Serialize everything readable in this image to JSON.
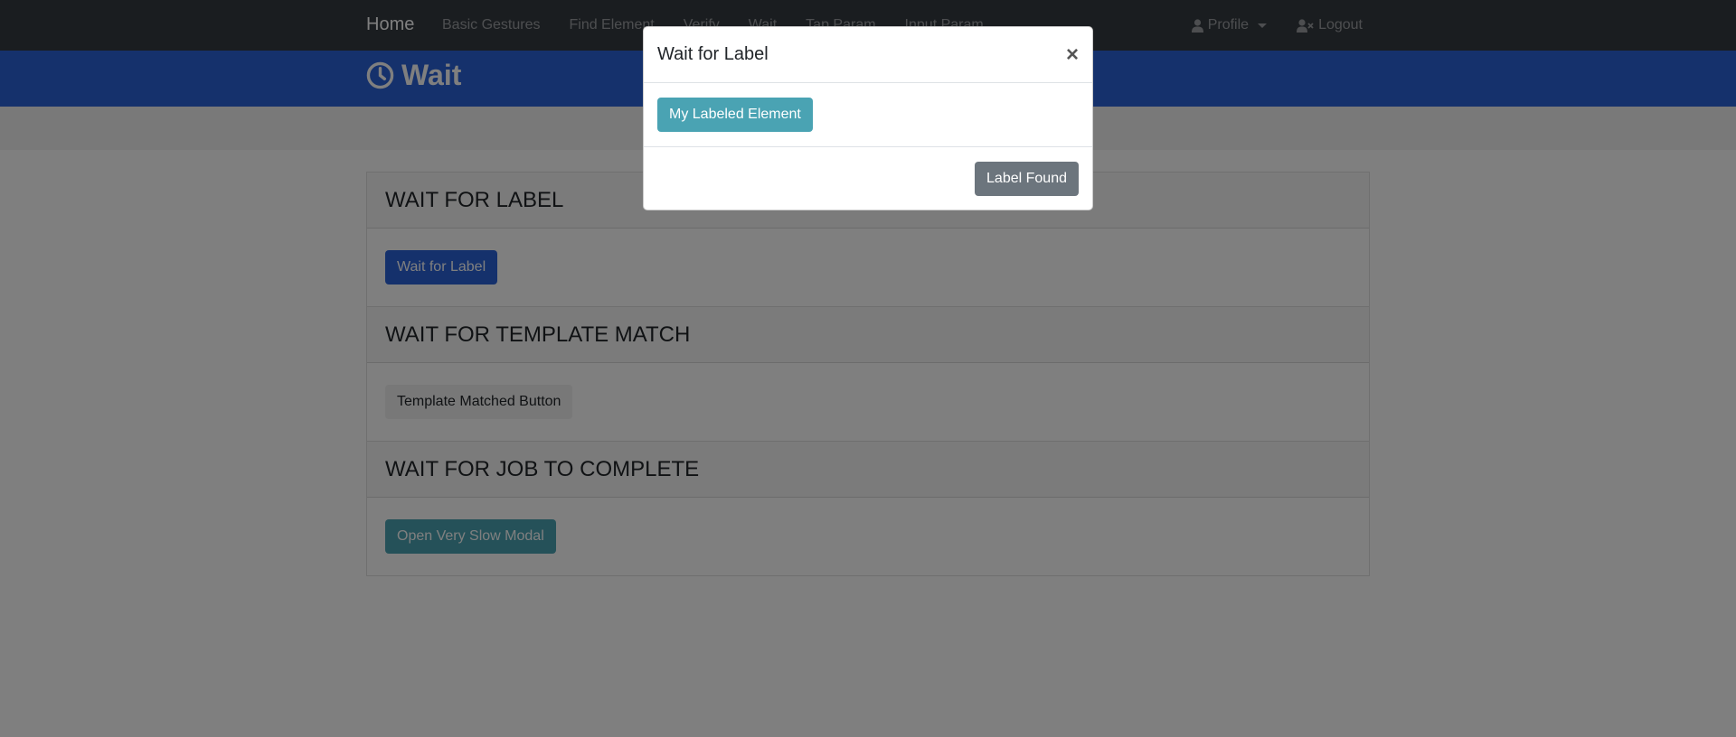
{
  "navbar": {
    "brand": "Home",
    "links": [
      "Basic Gestures",
      "Find Element",
      "Verify",
      "Wait",
      "Tap Param",
      "Input Param"
    ],
    "profile": "Profile",
    "logout": "Logout"
  },
  "header": {
    "title": "Wait",
    "icon": "clock-icon"
  },
  "cards": [
    {
      "title": "WAIT FOR LABEL",
      "button": "Wait for Label"
    },
    {
      "title": "WAIT FOR TEMPLATE MATCH",
      "button": "Template Matched Button"
    },
    {
      "title": "WAIT FOR JOB TO COMPLETE",
      "button": "Open Very Slow Modal"
    }
  ],
  "modal": {
    "title": "Wait for Label",
    "close": "×",
    "body_button": "My Labeled Element",
    "footer_button": "Label Found"
  },
  "colors": {
    "navbar": "#343a40",
    "header": "#2b62d9",
    "info": "#4aa3b3",
    "secondary": "#6c757d"
  }
}
